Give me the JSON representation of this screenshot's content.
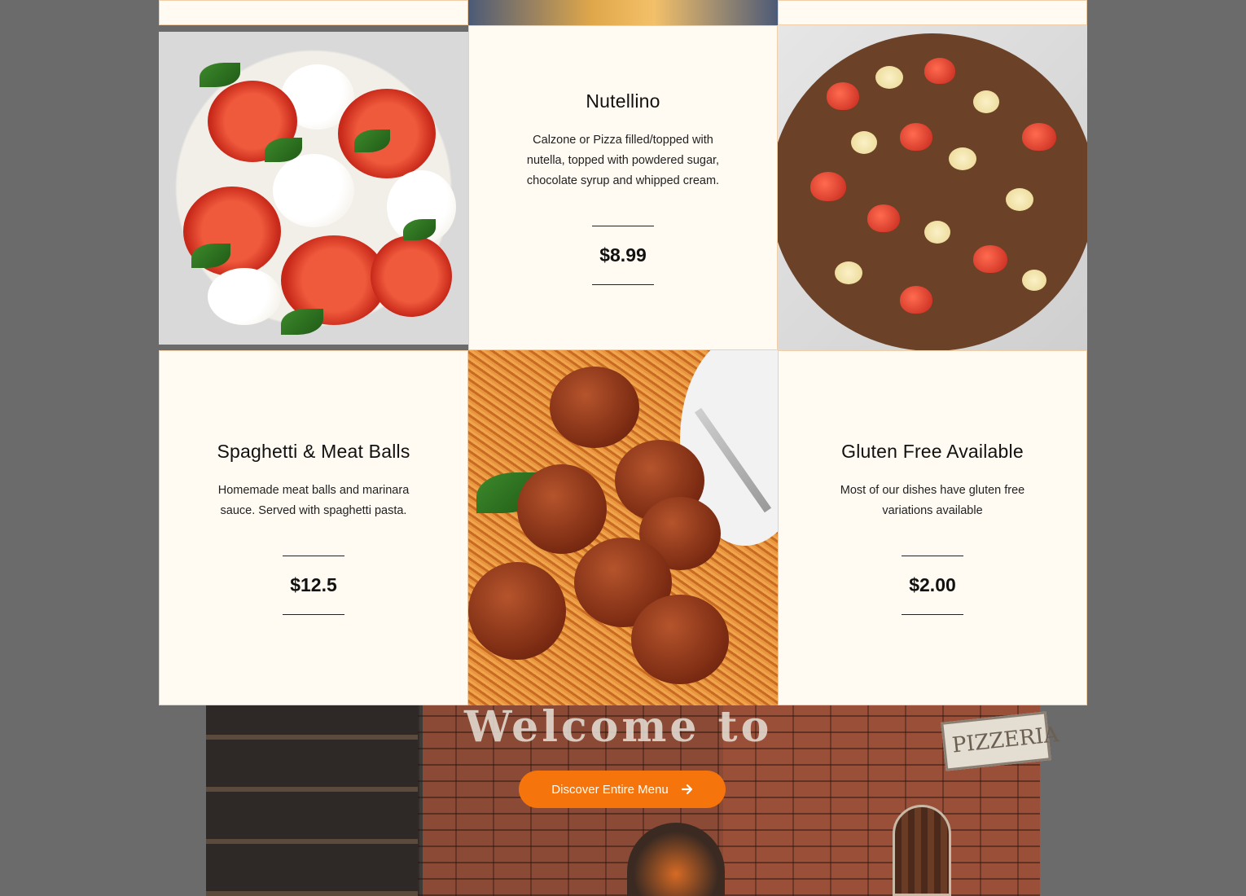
{
  "menu": {
    "items": [
      {
        "title": "Nutellino",
        "description": "Calzone or Pizza filled/topped with nutella, topped with powdered sugar, chocolate syrup and whipped cream.",
        "price": "$8.99"
      },
      {
        "title": "Spaghetti & Meat Balls",
        "description": "Homemade meat balls and marinara sauce. Served with spaghetti pasta.",
        "price": "$12.5"
      },
      {
        "title": "Gluten Free Available",
        "description": "Most of our dishes have gluten free variations available",
        "price": "$2.00"
      }
    ]
  },
  "photos": {
    "caprese": "caprese-salad-photo",
    "nutella_pizza": "nutella-pizza-photo",
    "spaghetti": "spaghetti-meatballs-photo",
    "restaurant": "restaurant-interior-photo"
  },
  "cta": {
    "label": "Discover Entire Menu",
    "icon": "arrow-right-icon",
    "color": "#f5740c"
  },
  "restaurant_wall": {
    "welcome": "Welcome to",
    "sign": "PIZZERIA"
  },
  "colors": {
    "card_bg": "#fffaf2",
    "card_border": "#f0cfa8"
  }
}
